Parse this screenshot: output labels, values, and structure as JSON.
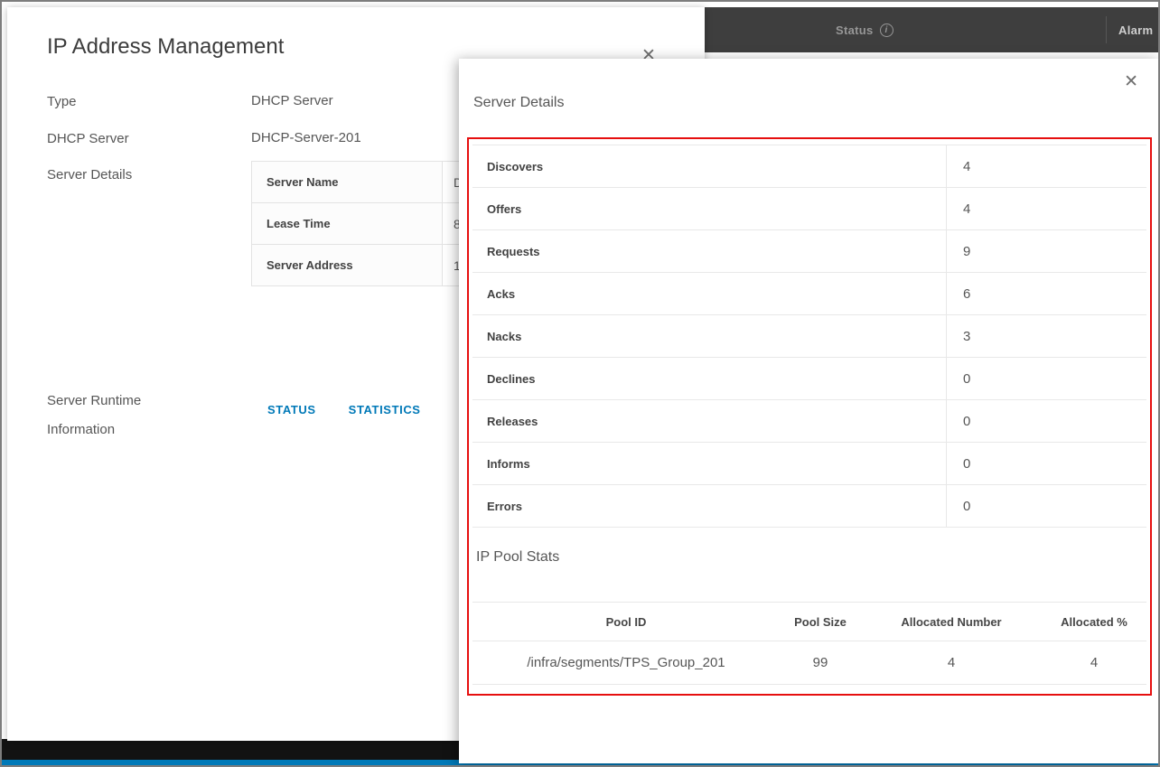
{
  "topbar": {
    "status_label": "Status",
    "info_icon": "i",
    "alarm_label": "Alarm"
  },
  "ipam_dialog": {
    "title": "IP Address Management",
    "close_icon": "✕",
    "fields": [
      {
        "label": "Type",
        "value": "DHCP Server"
      },
      {
        "label": "DHCP Server",
        "value": "DHCP-Server-201"
      },
      {
        "label": "Server Details",
        "value": ""
      }
    ],
    "details_table": {
      "rows": [
        {
          "label": "Server Name",
          "value": "D"
        },
        {
          "label": "Lease Time",
          "value": "8"
        },
        {
          "label": "Server Address",
          "value": "1"
        }
      ]
    },
    "runtime_label_line1": "Server Runtime",
    "runtime_label_line2": "Information",
    "tabs": [
      {
        "label": "STATUS"
      },
      {
        "label": "STATISTICS"
      }
    ]
  },
  "server_details_dialog": {
    "title": "Server Details",
    "close_icon": "✕",
    "stats_rows": [
      {
        "label": "Discovers",
        "value": "4"
      },
      {
        "label": "Offers",
        "value": "4"
      },
      {
        "label": "Requests",
        "value": "9"
      },
      {
        "label": "Acks",
        "value": "6"
      },
      {
        "label": "Nacks",
        "value": "3"
      },
      {
        "label": "Declines",
        "value": "0"
      },
      {
        "label": "Releases",
        "value": "0"
      },
      {
        "label": "Informs",
        "value": "0"
      },
      {
        "label": "Errors",
        "value": "0"
      }
    ],
    "pool_stats": {
      "title": "IP Pool Stats",
      "headers": [
        "Pool ID",
        "Pool Size",
        "Allocated Number",
        "Allocated %"
      ],
      "rows": [
        {
          "pool_id": "/infra/segments/TPS_Group_201",
          "pool_size": "99",
          "allocated_number": "4",
          "allocated_pct": "4"
        }
      ]
    }
  },
  "colors": {
    "accent_blue": "#0079b8",
    "annotation_red": "#e60f0f",
    "topbar_dark": "#3e3e3e",
    "bottom_blue": "#0079b8"
  }
}
